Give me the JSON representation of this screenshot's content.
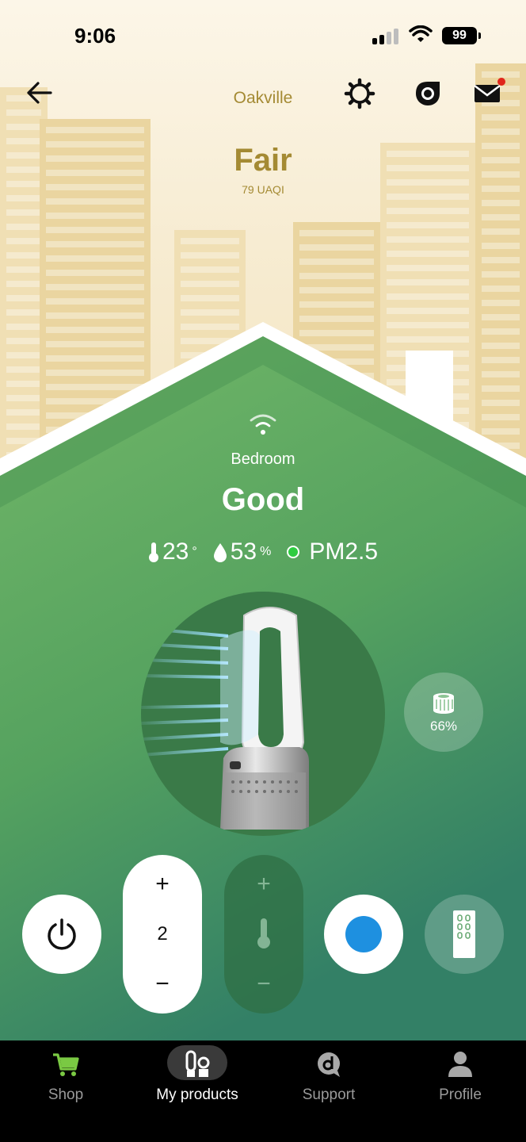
{
  "status_bar": {
    "time": "9:06",
    "battery": "99"
  },
  "header": {
    "location": "Oakville"
  },
  "outdoor": {
    "quality": "Fair",
    "index": "79 UAQI"
  },
  "room": {
    "name": "Bedroom",
    "quality": "Good",
    "temperature": "23",
    "temperature_unit": "°",
    "humidity": "53",
    "humidity_unit": "%",
    "pollutant": "PM2.5"
  },
  "filter": {
    "life": "66%"
  },
  "controls": {
    "fan_speed": "2",
    "plus": "+",
    "minus": "−",
    "mode_color": "#1e90e0"
  },
  "nav": {
    "items": [
      {
        "label": "Shop",
        "icon": "cart-icon"
      },
      {
        "label": "My products",
        "icon": "products-icon",
        "active": true
      },
      {
        "label": "Support",
        "icon": "support-icon"
      },
      {
        "label": "Profile",
        "icon": "profile-icon"
      }
    ]
  },
  "colors": {
    "accent_gold": "#a48a33",
    "house_green": "#4f9a5c",
    "cart_green": "#7ac943"
  }
}
